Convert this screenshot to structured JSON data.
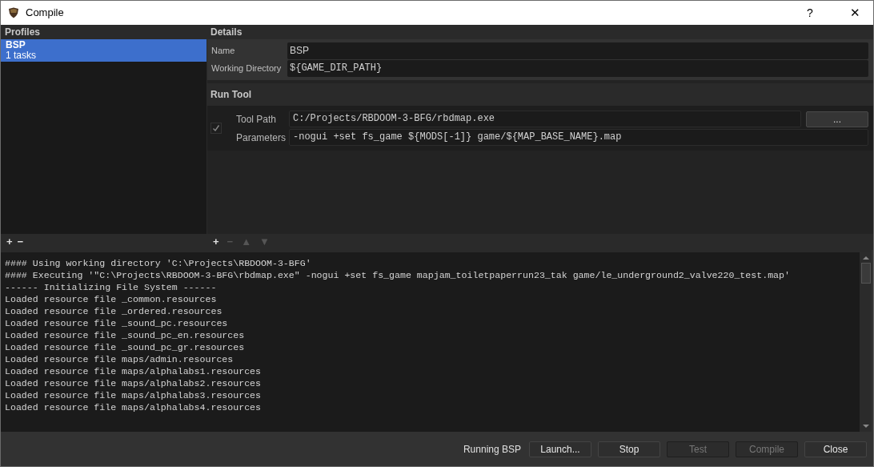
{
  "window": {
    "title": "Compile",
    "help": "?",
    "close": "✕"
  },
  "profiles": {
    "header": "Profiles",
    "items": [
      {
        "name": "BSP",
        "subtitle": "1 tasks",
        "selected": true
      }
    ],
    "toolbar": [
      {
        "label": "+",
        "disabled": false
      },
      {
        "label": "−",
        "disabled": false
      }
    ]
  },
  "details": {
    "header": "Details",
    "fields": [
      {
        "label": "Name",
        "value": "BSP",
        "kind": "text"
      },
      {
        "label": "Working Directory",
        "value": "${GAME_DIR_PATH}",
        "kind": "mono"
      }
    ]
  },
  "run_tool": {
    "header": "Run Tool",
    "checked": true,
    "tool_path": {
      "label": "Tool Path",
      "value": "C:/Projects/RBDOOM-3-BFG/rbdmap.exe"
    },
    "browse_button": "...",
    "parameters": {
      "label": "Parameters",
      "value": "-nogui +set fs_game ${MODS[-1]} game/${MAP_BASE_NAME}.map"
    }
  },
  "task_toolbar": [
    {
      "label": "+",
      "disabled": false
    },
    {
      "label": "−",
      "disabled": true
    },
    {
      "label": "▲",
      "disabled": true
    },
    {
      "label": "▼",
      "disabled": true
    }
  ],
  "log": [
    "#### Using working directory 'C:\\Projects\\RBDOOM-3-BFG'",
    "#### Executing '\"C:\\Projects\\RBDOOM-3-BFG\\rbdmap.exe\" -nogui +set fs_game mapjam_toiletpaperrun23_tak game/le_underground2_valve220_test.map'",
    "------ Initializing File System ------",
    "Loaded resource file _common.resources",
    "Loaded resource file _ordered.resources",
    "Loaded resource file _sound_pc.resources",
    "Loaded resource file _sound_pc_en.resources",
    "Loaded resource file _sound_pc_gr.resources",
    "Loaded resource file maps/admin.resources",
    "Loaded resource file maps/alphalabs1.resources",
    "Loaded resource file maps/alphalabs2.resources",
    "Loaded resource file maps/alphalabs3.resources",
    "Loaded resource file maps/alphalabs4.resources"
  ],
  "footer": {
    "status": "Running BSP",
    "buttons": [
      {
        "label": "Launch...",
        "disabled": false
      },
      {
        "label": "Stop",
        "disabled": false
      },
      {
        "label": "Test",
        "disabled": true
      },
      {
        "label": "Compile",
        "disabled": true
      },
      {
        "label": "Close",
        "disabled": false
      }
    ]
  }
}
